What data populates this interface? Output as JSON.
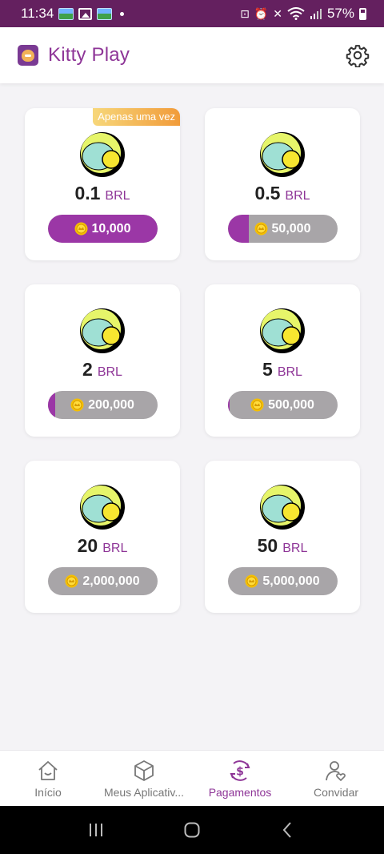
{
  "status_bar": {
    "time": "11:34",
    "battery": "57%"
  },
  "app_bar": {
    "title": "Kitty Play"
  },
  "offers": [
    {
      "amount": "0.1",
      "unit": "BRL",
      "coins": "10,000",
      "progress": 1.0,
      "badge": "Apenas uma vez"
    },
    {
      "amount": "0.5",
      "unit": "BRL",
      "coins": "50,000",
      "progress": 0.19
    },
    {
      "amount": "2",
      "unit": "BRL",
      "coins": "200,000",
      "progress": 0.07
    },
    {
      "amount": "5",
      "unit": "BRL",
      "coins": "500,000",
      "progress": 0.02
    },
    {
      "amount": "20",
      "unit": "BRL",
      "coins": "2,000,000",
      "progress": 0.0
    },
    {
      "amount": "50",
      "unit": "BRL",
      "coins": "5,000,000",
      "progress": 0.0
    }
  ],
  "bottom_nav": [
    {
      "label": "Início",
      "icon": "home-icon",
      "active": false
    },
    {
      "label": "Meus Aplicativ...",
      "icon": "cube-icon",
      "active": false
    },
    {
      "label": "Pagamentos",
      "icon": "dollar-icon",
      "active": true
    },
    {
      "label": "Convidar",
      "icon": "person-heart-icon",
      "active": false
    }
  ],
  "colors": {
    "brand": "#8e3597",
    "status_bar": "#64205f",
    "pill_bg": "#a8a5a8",
    "pill_fill": "#9b37a6"
  }
}
